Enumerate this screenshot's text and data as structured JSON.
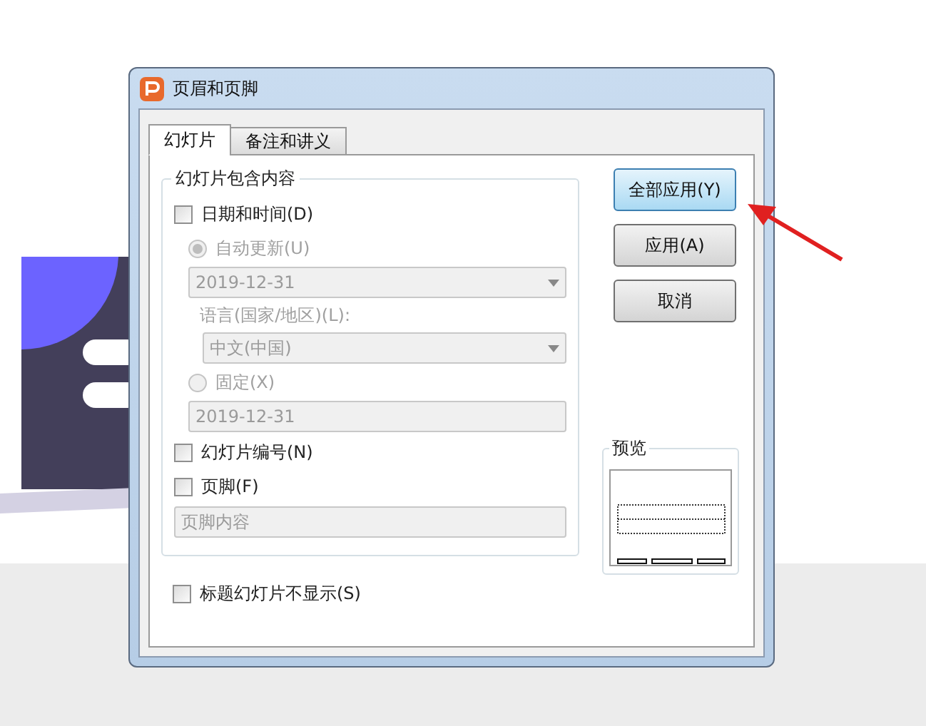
{
  "window": {
    "title": "页眉和页脚"
  },
  "tabs": [
    {
      "label": "幻灯片",
      "selected": true
    },
    {
      "label": "备注和讲义",
      "selected": false
    }
  ],
  "group": {
    "title": "幻灯片包含内容"
  },
  "date_time": {
    "label": "日期和时间(D)",
    "checked": false
  },
  "auto_update": {
    "label": "自动更新(U)",
    "selected": true,
    "disabled": true,
    "value": "2019-12-31"
  },
  "language": {
    "label": "语言(国家/地区)(L):",
    "value": "中文(中国)",
    "disabled": true
  },
  "fixed": {
    "label": "固定(X)",
    "selected": false,
    "disabled": true,
    "value": "2019-12-31"
  },
  "slide_number": {
    "label": "幻灯片编号(N)",
    "checked": false
  },
  "footer": {
    "label": "页脚(F)",
    "checked": false,
    "placeholder": "页脚内容"
  },
  "hide_on_title": {
    "label": "标题幻灯片不显示(S)",
    "checked": false
  },
  "buttons": [
    {
      "label": "全部应用(Y)",
      "selected": true
    },
    {
      "label": "应用(A)",
      "selected": false
    },
    {
      "label": "取消",
      "selected": false
    }
  ],
  "preview": {
    "title": "预览"
  }
}
